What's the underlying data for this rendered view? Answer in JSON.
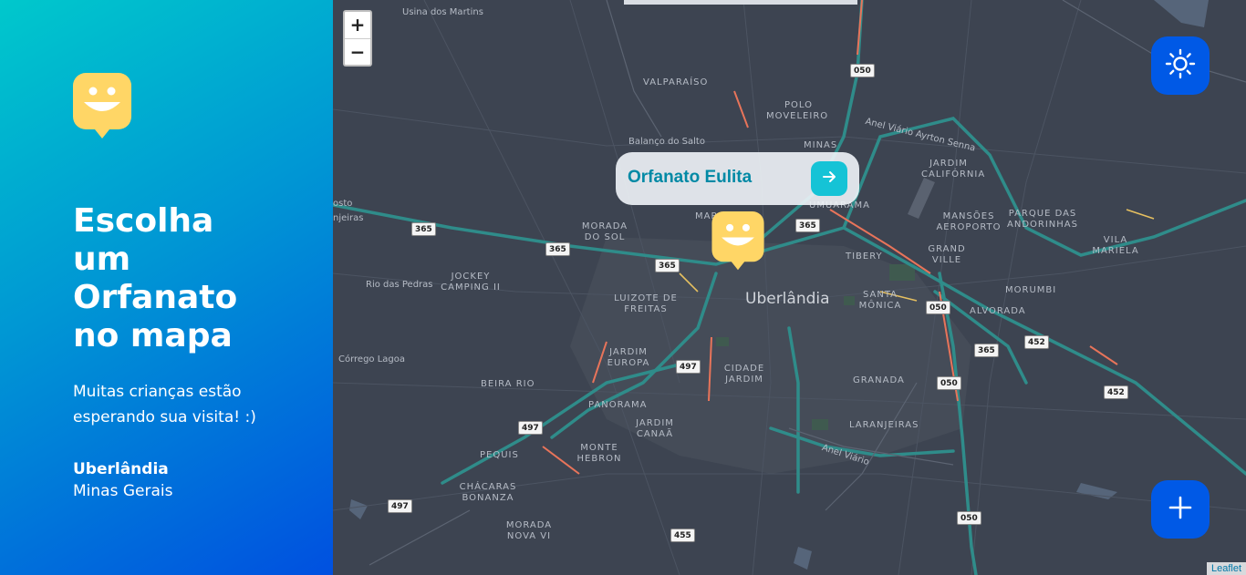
{
  "sidebar": {
    "headline": "Escolha um Orfanato no mapa",
    "subtitle": "Muitas crianças estão esperando sua visita! :)",
    "city": "Uberlândia",
    "state": "Minas Gerais",
    "logo_icon": "smiley-map-pin-icon",
    "gradient_colors": [
      "#00c8cc",
      "#0050e0"
    ]
  },
  "map": {
    "zoom_in_label": "+",
    "zoom_out_label": "−",
    "attribution": "Leaflet",
    "labels": {
      "usina": "Usina dos Martins",
      "valparaiso": "VALPARAÍSO",
      "polo": "POLO",
      "moveleiro": "MOVELEIRO",
      "balanco": "Balanço do Salto",
      "minas": "MINAS",
      "anel_ayrton": "Anel Viário Ayrton Senna",
      "jardim_california": "JARDIM CALIFÓRNIA",
      "mansoes": "MANSÕES AEROPORTO",
      "parque_andorinhas": "PARQUE DAS ANDORINHAS",
      "vila_mariela": "VILA MARIELA",
      "morada_sol": "MORADA DO SOL",
      "marajoara": "MARAJOARA",
      "umuarama": "UMUARAMA",
      "grand_ville": "GRAND VILLE",
      "tibery": "TIBERY",
      "jockey": "JOCKEY CAMPING II",
      "rio_pedras": "Rio das Pedras",
      "uberlandia": "Uberlândia",
      "santa_monica": "SANTA MÔNICA",
      "morumbi": "MORUMBI",
      "alvorada": "ALVORADA",
      "luizote": "LUIZOTE DE FREITAS",
      "jardim_europa": "JARDIM EUROPA",
      "corrego": "Córrego Lagoa",
      "cidade_jardim": "CIDADE JARDIM",
      "granada": "GRANADA",
      "beira_rio": "BEIRA RIO",
      "panorama": "PANORAMA",
      "jardim_canaa": "JARDIM CANAÃ",
      "laranjeiras": "LARANJEIRAS",
      "anel_viario": "Anel Viário",
      "pequis": "PEQUIS",
      "monte_hebron": "MONTE HEBRON",
      "chacaras": "CHÁCARAS BONANZA",
      "morada_nova": "MORADA NOVA VI",
      "sto": "osto",
      "njeiras": "njeiras"
    },
    "shields": {
      "s050a": "050",
      "s365a": "365",
      "s365b": "365",
      "s365c": "365",
      "s365d": "365",
      "s050b": "050",
      "s365e": "365",
      "s452a": "452",
      "s050c": "050",
      "s497a": "497",
      "s452b": "452",
      "s497b": "497",
      "s497c": "497",
      "s455": "455",
      "s050d": "050"
    }
  },
  "popup": {
    "orphanage_name": "Orfanato Eulita",
    "go_icon": "arrow-right-icon"
  },
  "buttons": {
    "theme_icon": "sun-icon",
    "add_icon": "plus-icon",
    "color": "#0059e6"
  }
}
